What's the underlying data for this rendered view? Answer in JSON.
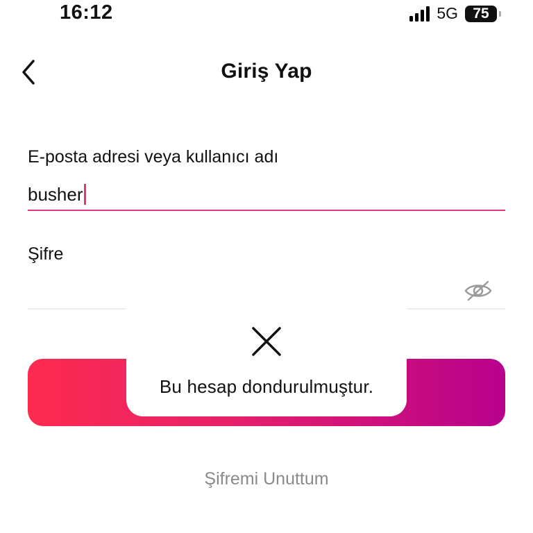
{
  "status_bar": {
    "time": "16:12",
    "network": "5G",
    "battery": "75"
  },
  "header": {
    "title": "Giriş Yap",
    "back_icon": "chevron-left-icon"
  },
  "form": {
    "email_label": "E-posta adresi veya kullanıcı adı",
    "email_value": "busher",
    "password_label": "Şifre",
    "password_value": "",
    "password_toggle_icon": "eye-off-icon"
  },
  "login_button": {
    "gradient_start": "#ff2b4f",
    "gradient_end": "#b8018d"
  },
  "forgot_password": "Şifremi Unuttum",
  "toast": {
    "icon": "close-x-icon",
    "message": "Bu hesap dondurulmuştur."
  },
  "colors": {
    "accent": "#e0357a",
    "muted_text": "#8a8a8a"
  }
}
